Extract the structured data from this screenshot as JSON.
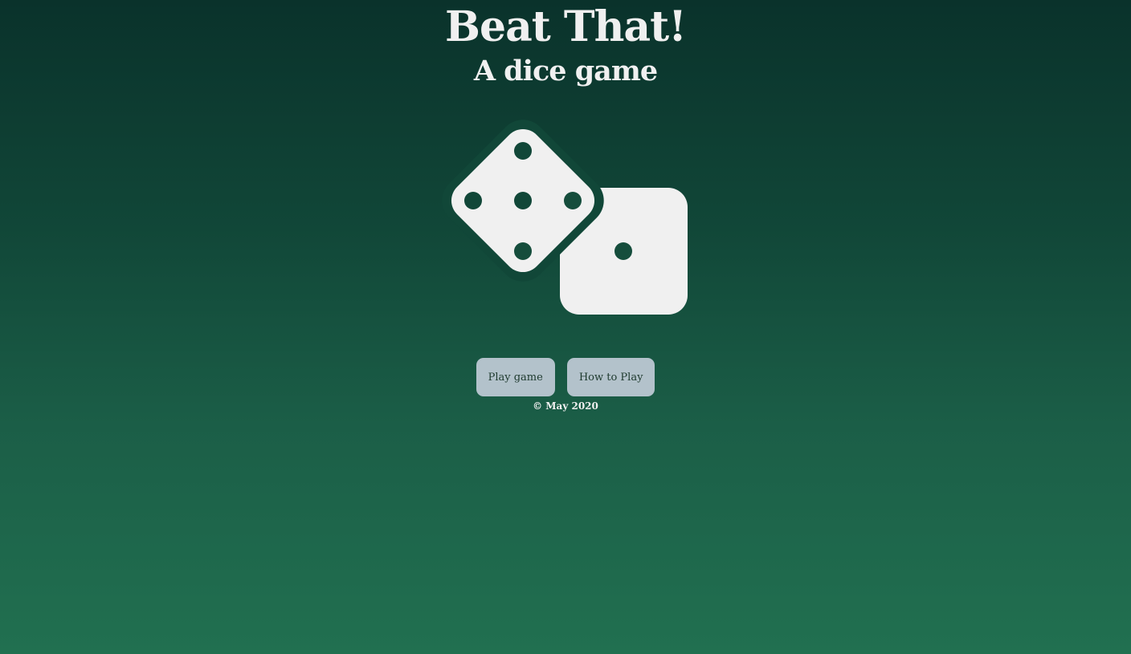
{
  "header": {
    "title": "Beat That!",
    "subtitle": "A dice game"
  },
  "logo": {
    "icon": "dice-icon",
    "color": "#f0f0f0"
  },
  "buttons": {
    "play_label": "Play game",
    "how_label": "How to Play"
  },
  "footer": {
    "copyright": "© May 2020"
  },
  "colors": {
    "background_top": "#0a322b",
    "background_bottom": "#217050",
    "button_bg": "#b3c2cb",
    "button_text": "#1e3a2e",
    "text": "#f0f0f0"
  }
}
